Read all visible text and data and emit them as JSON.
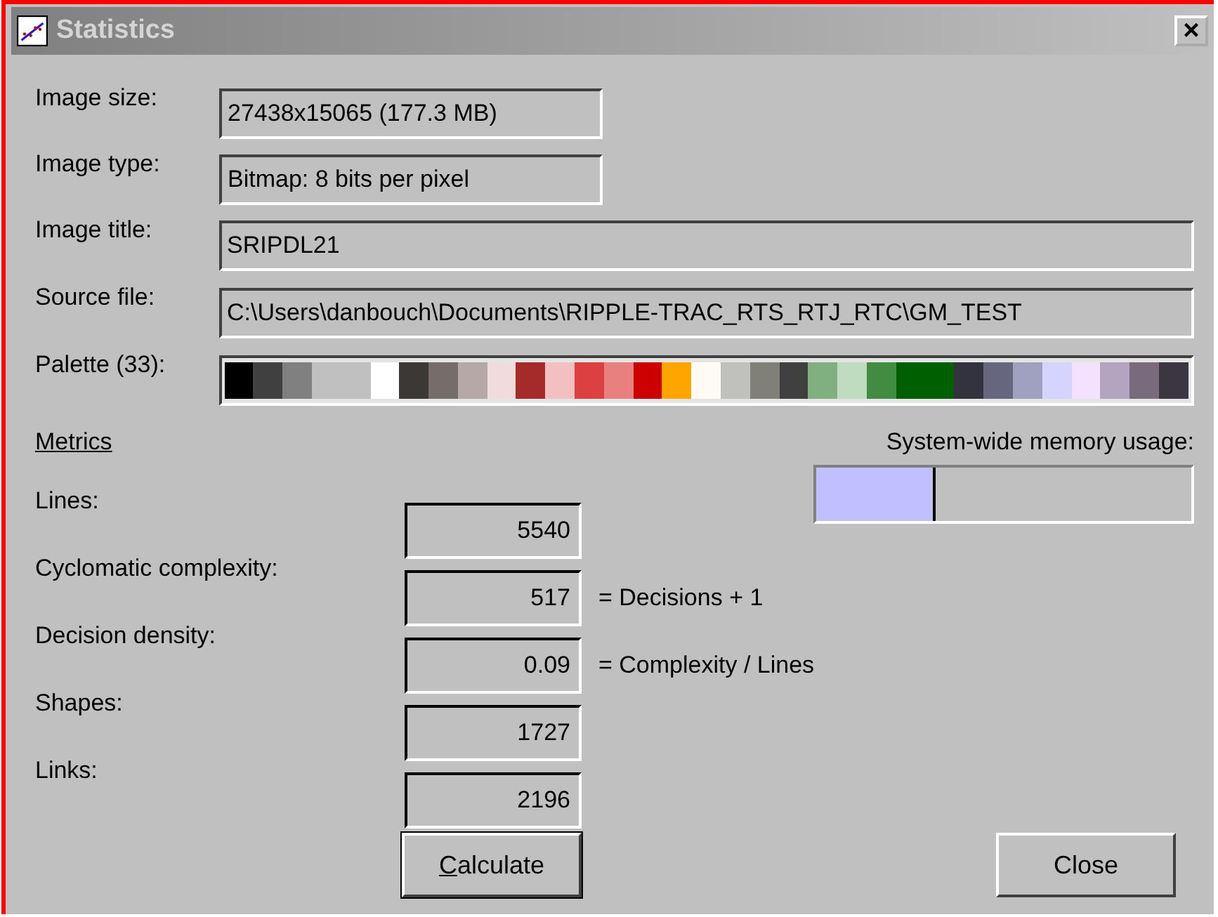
{
  "window": {
    "title": "Statistics",
    "close_glyph": "×"
  },
  "info": [
    {
      "label": "Image size:",
      "value": "27438x15065 (177.3 MB)"
    },
    {
      "label": "Image type:",
      "value": "Bitmap: 8 bits per pixel"
    },
    {
      "label": "Image title:",
      "value": "SRIPDL21"
    },
    {
      "label": "Source file:",
      "value": "C:\\Users\\danbouch\\Documents\\RIPPLE-TRAC_RTS_RTJ_RTC\\GM_TEST"
    }
  ],
  "palette": {
    "label": "Palette (33):",
    "colors": [
      {
        "color": "#000000"
      },
      {
        "color": "#404040"
      },
      {
        "color": "#808080"
      },
      {
        "color": "#c0c0c0"
      },
      {
        "color": "#c0c0c0"
      },
      {
        "color": "#ffffff"
      },
      {
        "color": "#3c3836"
      },
      {
        "color": "#766d6a"
      },
      {
        "color": "#b5a8a6"
      },
      {
        "color": "#f0dcdc"
      },
      {
        "color": "#a52a2a"
      },
      {
        "color": "#f2c0c0"
      },
      {
        "color": "#dc4040"
      },
      {
        "color": "#e88080"
      },
      {
        "color": "#cc0000"
      },
      {
        "color": "#ffa500"
      },
      {
        "color": "#fffaf2"
      },
      {
        "color": "#c0c0bc"
      },
      {
        "color": "#808078"
      },
      {
        "color": "#404040"
      },
      {
        "color": "#80b080"
      },
      {
        "color": "#c0dcc0"
      },
      {
        "color": "#408c40"
      },
      {
        "color": "#006000"
      },
      {
        "color": "#006000"
      },
      {
        "color": "#33333f"
      },
      {
        "color": "#66667e"
      },
      {
        "color": "#a0a0c0"
      },
      {
        "color": "#d4d4ff"
      },
      {
        "color": "#f4e0ff"
      },
      {
        "color": "#b4a4c0"
      },
      {
        "color": "#7a6a7e"
      },
      {
        "color": "#3c3640"
      }
    ]
  },
  "metrics_heading": "Metrics",
  "memory": {
    "label": "System-wide memory usage:",
    "level": 0.32
  },
  "metrics": [
    {
      "label": "Lines:",
      "value": "5540"
    },
    {
      "label": "Cyclomatic complexity:",
      "value": "517",
      "note": "= Decisions + 1"
    },
    {
      "label": "Decision density:",
      "value": "0.09",
      "note": "= Complexity / Lines"
    },
    {
      "label": "Shapes:",
      "value": "1727"
    },
    {
      "label": "Links:",
      "value": "2196"
    }
  ],
  "buttons": {
    "calculate": "Calculate",
    "close": "Close"
  }
}
